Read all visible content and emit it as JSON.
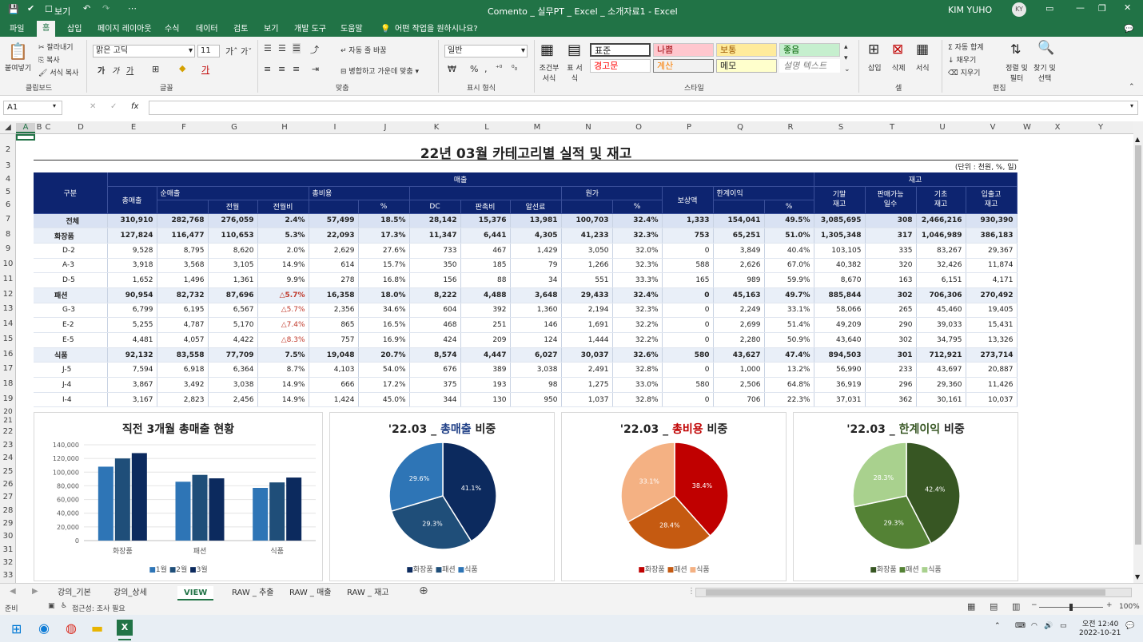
{
  "title_bar": {
    "save_icon": "save-icon",
    "autosave_label": "보기",
    "file_title": "Comento _ 실무PT _ Excel _ 소개자료1 - Excel",
    "user": "KIM YUHO",
    "avatar": "KY"
  },
  "ribbon_tabs": [
    "파일",
    "홈",
    "삽입",
    "페이지 레이아웃",
    "수식",
    "데이터",
    "검토",
    "보기",
    "개발 도구",
    "도움말"
  ],
  "tell_me": "어떤 작업을 원하시나요?",
  "ribbon": {
    "clipboard": {
      "paste": "붙여넣기",
      "cut": "잘라내기",
      "copy": "복사",
      "format_copy": "서식 복사",
      "group": "클립보드"
    },
    "font": {
      "family": "맑은 고딕",
      "size": "11",
      "group": "글꼴"
    },
    "align": {
      "wrap": "자동 줄 바꿈",
      "merge": "병합하고 가운데 맞춤",
      "group": "맞춤"
    },
    "number": {
      "format": "일반",
      "group": "표시 형식"
    },
    "styles": {
      "cond": "조건부 서식",
      "table": "표 서식",
      "s_normal": "표준",
      "s_bad": "나쁨",
      "s_neutral": "보통",
      "s_good": "좋음",
      "s_warn": "경고문",
      "s_calc": "계산",
      "s_memo": "메모",
      "s_explain": "설명 텍스트",
      "group": "스타일"
    },
    "cells": {
      "insert": "삽입",
      "delete": "삭제",
      "format": "서식",
      "group": "셀"
    },
    "editing": {
      "autosum": "자동 합계",
      "fill": "채우기",
      "clear": "지우기",
      "sort": "정렬 및 필터",
      "find": "찾기 및 선택",
      "group": "편집"
    }
  },
  "name_box": "A1",
  "formula": "",
  "columns": [
    "A",
    "B",
    "C",
    "D",
    "E",
    "F",
    "G",
    "H",
    "I",
    "J",
    "K",
    "L",
    "M",
    "N",
    "O",
    "P",
    "Q",
    "R",
    "S",
    "T",
    "U",
    "V",
    "W",
    "X",
    "Y"
  ],
  "rows": [
    "2",
    "3",
    "4",
    "5",
    "6",
    "7",
    "8",
    "9",
    "10",
    "11",
    "12",
    "13",
    "14",
    "15",
    "16",
    "17",
    "18",
    "19",
    "20",
    "21",
    "22",
    "23",
    "24",
    "25",
    "26",
    "27",
    "28",
    "29",
    "30",
    "31",
    "32",
    "33"
  ],
  "report": {
    "title": "22년 03월 카테고리별 실적 및 재고",
    "unit": "(단위 : 천원, %, 일)",
    "h_group": "구분",
    "h_sales": "매출",
    "h_stock": "재고",
    "h_gross": "총매출",
    "h_net": "순매출",
    "h_prev": "전월",
    "h_mom": "전월비",
    "h_cost": "총비용",
    "h_pct": "%",
    "h_dc": "DC",
    "h_promo": "판촉비",
    "h_fee": "알선료",
    "h_cogs": "원가",
    "h_comp": "보상액",
    "h_margin": "한계이익",
    "h_stock_end": "기말\n재고",
    "h_days": "판매가능\n일수",
    "h_stock_begin": "기초\n재고",
    "h_inout": "입출고\n재고",
    "rows": [
      {
        "kind": "tot",
        "c": [
          "전체",
          "310,910",
          "282,768",
          "276,059",
          "2.4%",
          "57,499",
          "18.5%",
          "28,142",
          "15,376",
          "13,981",
          "100,703",
          "32.4%",
          "1,333",
          "154,041",
          "49.5%",
          "3,085,695",
          "308",
          "2,466,216",
          "930,390"
        ]
      },
      {
        "kind": "cat",
        "c": [
          "화장품",
          "127,824",
          "116,477",
          "110,653",
          "5.3%",
          "22,093",
          "17.3%",
          "11,347",
          "6,441",
          "4,305",
          "41,233",
          "32.3%",
          "753",
          "65,251",
          "51.0%",
          "1,305,348",
          "317",
          "1,046,989",
          "386,183"
        ]
      },
      {
        "kind": "item",
        "c": [
          "D-2",
          "9,528",
          "8,795",
          "8,620",
          "2.0%",
          "2,629",
          "27.6%",
          "733",
          "467",
          "1,429",
          "3,050",
          "32.0%",
          "0",
          "3,849",
          "40.4%",
          "103,105",
          "335",
          "83,267",
          "29,367"
        ]
      },
      {
        "kind": "item",
        "c": [
          "A-3",
          "3,918",
          "3,568",
          "3,105",
          "14.9%",
          "614",
          "15.7%",
          "350",
          "185",
          "79",
          "1,266",
          "32.3%",
          "588",
          "2,626",
          "67.0%",
          "40,382",
          "320",
          "32,426",
          "11,874"
        ]
      },
      {
        "kind": "item",
        "c": [
          "D-5",
          "1,652",
          "1,496",
          "1,361",
          "9.9%",
          "278",
          "16.8%",
          "156",
          "88",
          "34",
          "551",
          "33.3%",
          "165",
          "989",
          "59.9%",
          "8,670",
          "163",
          "6,151",
          "4,171"
        ]
      },
      {
        "kind": "cat",
        "c": [
          "패션",
          "90,954",
          "82,732",
          "87,696",
          "△5.7%",
          "16,358",
          "18.0%",
          "8,222",
          "4,488",
          "3,648",
          "29,433",
          "32.4%",
          "0",
          "45,163",
          "49.7%",
          "885,844",
          "302",
          "706,306",
          "270,492"
        ]
      },
      {
        "kind": "item",
        "c": [
          "G-3",
          "6,799",
          "6,195",
          "6,567",
          "△5.7%",
          "2,356",
          "34.6%",
          "604",
          "392",
          "1,360",
          "2,194",
          "32.3%",
          "0",
          "2,249",
          "33.1%",
          "58,066",
          "265",
          "45,460",
          "19,405"
        ]
      },
      {
        "kind": "item",
        "c": [
          "E-2",
          "5,255",
          "4,787",
          "5,170",
          "△7.4%",
          "865",
          "16.5%",
          "468",
          "251",
          "146",
          "1,691",
          "32.2%",
          "0",
          "2,699",
          "51.4%",
          "49,209",
          "290",
          "39,033",
          "15,431"
        ]
      },
      {
        "kind": "item",
        "c": [
          "E-5",
          "4,481",
          "4,057",
          "4,422",
          "△8.3%",
          "757",
          "16.9%",
          "424",
          "209",
          "124",
          "1,444",
          "32.2%",
          "0",
          "2,280",
          "50.9%",
          "43,640",
          "302",
          "34,795",
          "13,326"
        ]
      },
      {
        "kind": "cat",
        "c": [
          "식품",
          "92,132",
          "83,558",
          "77,709",
          "7.5%",
          "19,048",
          "20.7%",
          "8,574",
          "4,447",
          "6,027",
          "30,037",
          "32.6%",
          "580",
          "43,627",
          "47.4%",
          "894,503",
          "301",
          "712,921",
          "273,714"
        ]
      },
      {
        "kind": "item",
        "c": [
          "J-5",
          "7,594",
          "6,918",
          "6,364",
          "8.7%",
          "4,103",
          "54.0%",
          "676",
          "389",
          "3,038",
          "2,491",
          "32.8%",
          "0",
          "1,000",
          "13.2%",
          "56,990",
          "233",
          "43,697",
          "20,887"
        ]
      },
      {
        "kind": "item",
        "c": [
          "J-4",
          "3,867",
          "3,492",
          "3,038",
          "14.9%",
          "666",
          "17.2%",
          "375",
          "193",
          "98",
          "1,275",
          "33.0%",
          "580",
          "2,506",
          "64.8%",
          "36,919",
          "296",
          "29,360",
          "11,426"
        ]
      },
      {
        "kind": "item",
        "c": [
          "I-4",
          "3,167",
          "2,823",
          "2,456",
          "14.9%",
          "1,424",
          "45.0%",
          "344",
          "130",
          "950",
          "1,037",
          "32.8%",
          "0",
          "706",
          "22.3%",
          "37,031",
          "362",
          "30,161",
          "10,037"
        ]
      }
    ]
  },
  "chart_data": [
    {
      "type": "bar",
      "title": "직전 3개월 총매출 현황",
      "categories": [
        "화장품",
        "패션",
        "식품"
      ],
      "series": [
        {
          "name": "1월",
          "values": [
            108000,
            86000,
            77000
          ]
        },
        {
          "name": "2월",
          "values": [
            120000,
            96000,
            85000
          ]
        },
        {
          "name": "3월",
          "values": [
            127824,
            90954,
            92132
          ]
        }
      ],
      "ylim": [
        0,
        140000
      ],
      "yticks": [
        "140,000",
        "120,000",
        "100,000",
        "80,000",
        "60,000",
        "40,000",
        "20,000",
        "0"
      ],
      "colors": [
        "#2e75b6",
        "#1f4e79",
        "#0c2a5e"
      ]
    },
    {
      "type": "pie",
      "title_prefix": "'22.03 _ ",
      "title_hl": "총매출",
      "title_suffix": " 비중",
      "hl_color": "#1f3f86",
      "labels": [
        "화장품",
        "패션",
        "식품"
      ],
      "values": [
        41.1,
        29.3,
        29.6
      ],
      "display": [
        "41.1%",
        "29.3%",
        "29.6%"
      ],
      "colors": [
        "#0c2a5e",
        "#1f4e79",
        "#2e75b6"
      ]
    },
    {
      "type": "pie",
      "title_prefix": "'22.03 _ ",
      "title_hl": "총비용",
      "title_suffix": " 비중",
      "hl_color": "#c00000",
      "labels": [
        "화장품",
        "패션",
        "식품"
      ],
      "values": [
        38.4,
        28.4,
        33.1
      ],
      "display": [
        "38.4%",
        "28.4%",
        "33.1%"
      ],
      "colors": [
        "#c00000",
        "#c55a11",
        "#f4b183"
      ]
    },
    {
      "type": "pie",
      "title_prefix": "'22.03 _ ",
      "title_hl": "한계이익",
      "title_suffix": " 비중",
      "hl_color": "#375623",
      "labels": [
        "화장품",
        "패션",
        "식품"
      ],
      "values": [
        42.4,
        29.3,
        28.3
      ],
      "display": [
        "42.4%",
        "29.3%",
        "28.3%"
      ],
      "colors": [
        "#375623",
        "#548235",
        "#a9d18e"
      ]
    }
  ],
  "sheet_tabs": [
    "강의_기본",
    "강의_상세",
    "VIEW",
    "RAW _ 추출",
    "RAW _ 매출",
    "RAW _ 재고"
  ],
  "status": {
    "ready": "준비",
    "access": "접근성: 조사 필요",
    "zoom": "100%"
  },
  "taskbar": {
    "time": "오전 12:40",
    "date": "2022-10-21"
  }
}
